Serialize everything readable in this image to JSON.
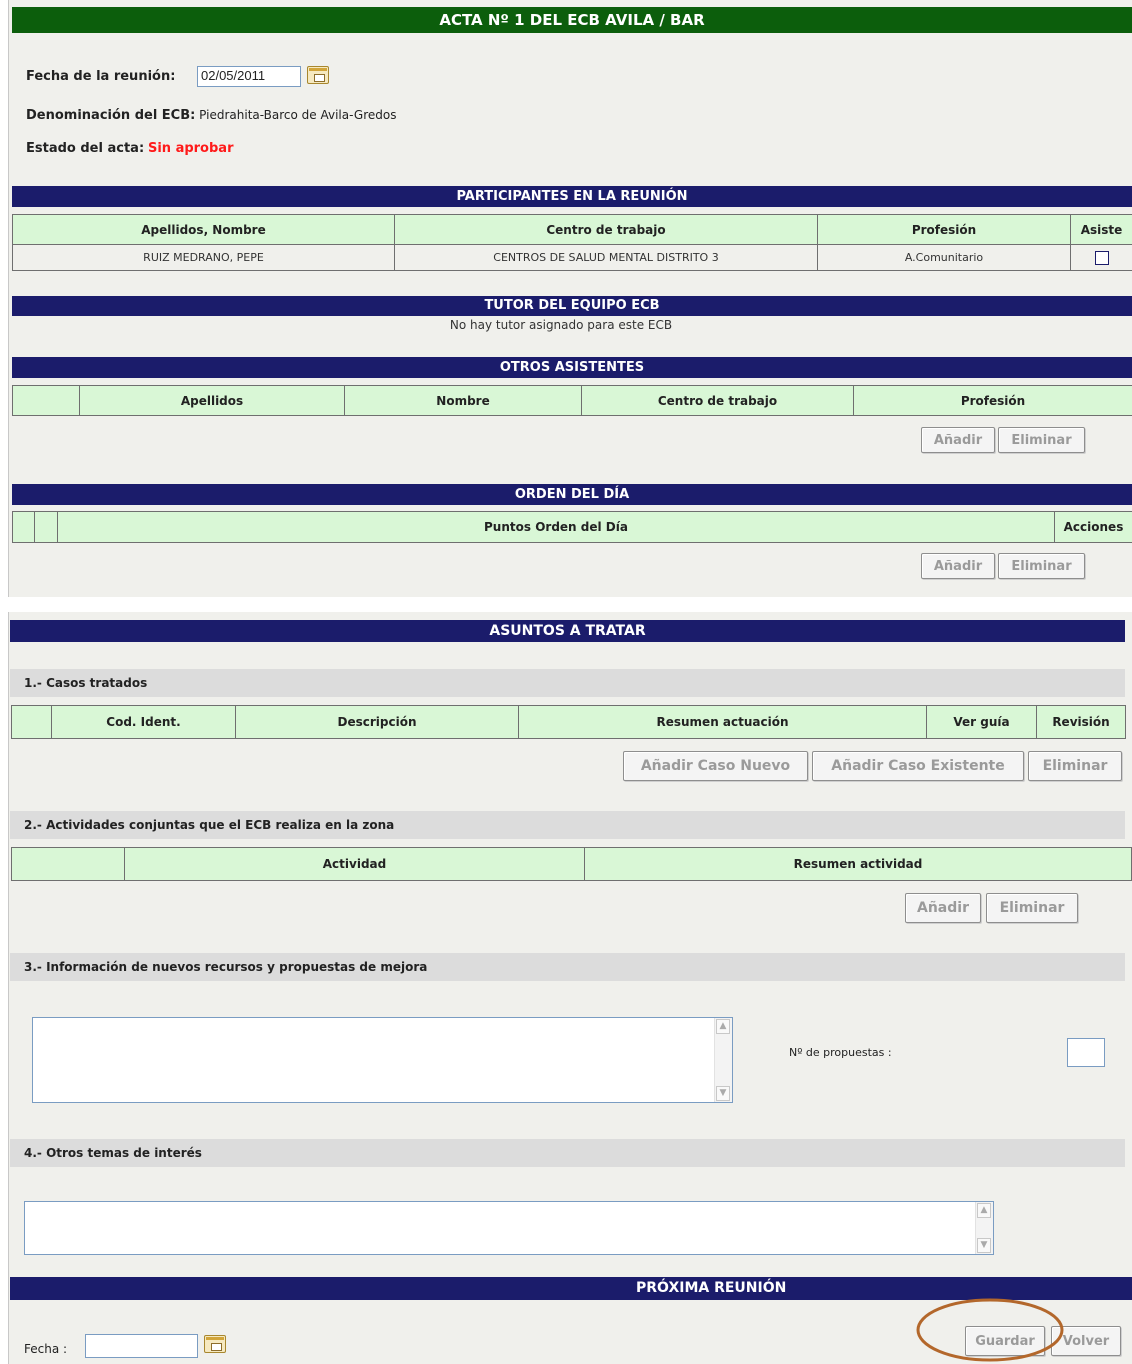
{
  "header": {
    "title": "ACTA Nº 1 DEL ECB AVILA / BAR"
  },
  "meeting": {
    "date_label": "Fecha de la reunión:",
    "date_value": "02/05/2011",
    "ecb_label": "Denominación del ECB:",
    "ecb_value": "Piedrahita-Barco de Avila-Gredos",
    "status_label": "Estado del acta:",
    "status_value": "Sin aprobar",
    "status_color": "#ff1a1a"
  },
  "participants": {
    "title": "PARTICIPANTES EN LA REUNIÓN",
    "columns": [
      "Apellidos, Nombre",
      "Centro de trabajo",
      "Profesión",
      "Asiste"
    ],
    "rows": [
      {
        "name": "RUIZ MEDRANO, PEPE",
        "centro": "CENTROS DE SALUD MENTAL DISTRITO 3",
        "profesion": "A.Comunitario",
        "asiste": false
      }
    ]
  },
  "tutor": {
    "title": "TUTOR DEL EQUIPO ECB",
    "message": "No hay tutor asignado para este ECB"
  },
  "otros_asistentes": {
    "title": "OTROS ASISTENTES",
    "columns": [
      "",
      "Apellidos",
      "Nombre",
      "Centro de trabajo",
      "Profesión"
    ],
    "add_label": "Añadir",
    "delete_label": "Eliminar"
  },
  "orden_dia": {
    "title": "ORDEN DEL DÍA",
    "columns": [
      "",
      "",
      "Puntos Orden del Día",
      "Acciones"
    ],
    "add_label": "Añadir",
    "delete_label": "Eliminar"
  },
  "asuntos": {
    "title": "ASUNTOS A TRATAR",
    "casos": {
      "title": "1.- Casos tratados",
      "columns": [
        "",
        "Cod. Ident.",
        "Descripción",
        "Resumen actuación",
        "Ver guía",
        "Revisión"
      ],
      "add_new_label": "Añadir Caso Nuevo",
      "add_existing_label": "Añadir Caso Existente",
      "delete_label": "Eliminar"
    },
    "actividades": {
      "title": "2.- Actividades conjuntas que el ECB realiza en la zona",
      "columns": [
        "",
        "Actividad",
        "Resumen actividad"
      ],
      "add_label": "Añadir",
      "delete_label": "Eliminar"
    },
    "recursos": {
      "title": "3.- Información de nuevos recursos y propuestas de mejora",
      "propuestas_label": "Nº de propuestas :",
      "propuestas_value": ""
    },
    "otros": {
      "title": "4.- Otros temas de interés"
    }
  },
  "proxima": {
    "title": "PRÓXIMA REUNIÓN",
    "fecha_label": "Fecha :",
    "fecha_value": "",
    "save_label": "Guardar",
    "back_label": "Volver"
  },
  "colors": {
    "header_green": "#0c5e0c",
    "section_navy": "#1b1c6b",
    "table_header": "#d9f7d6",
    "highlight_circle": "#b3672b"
  }
}
